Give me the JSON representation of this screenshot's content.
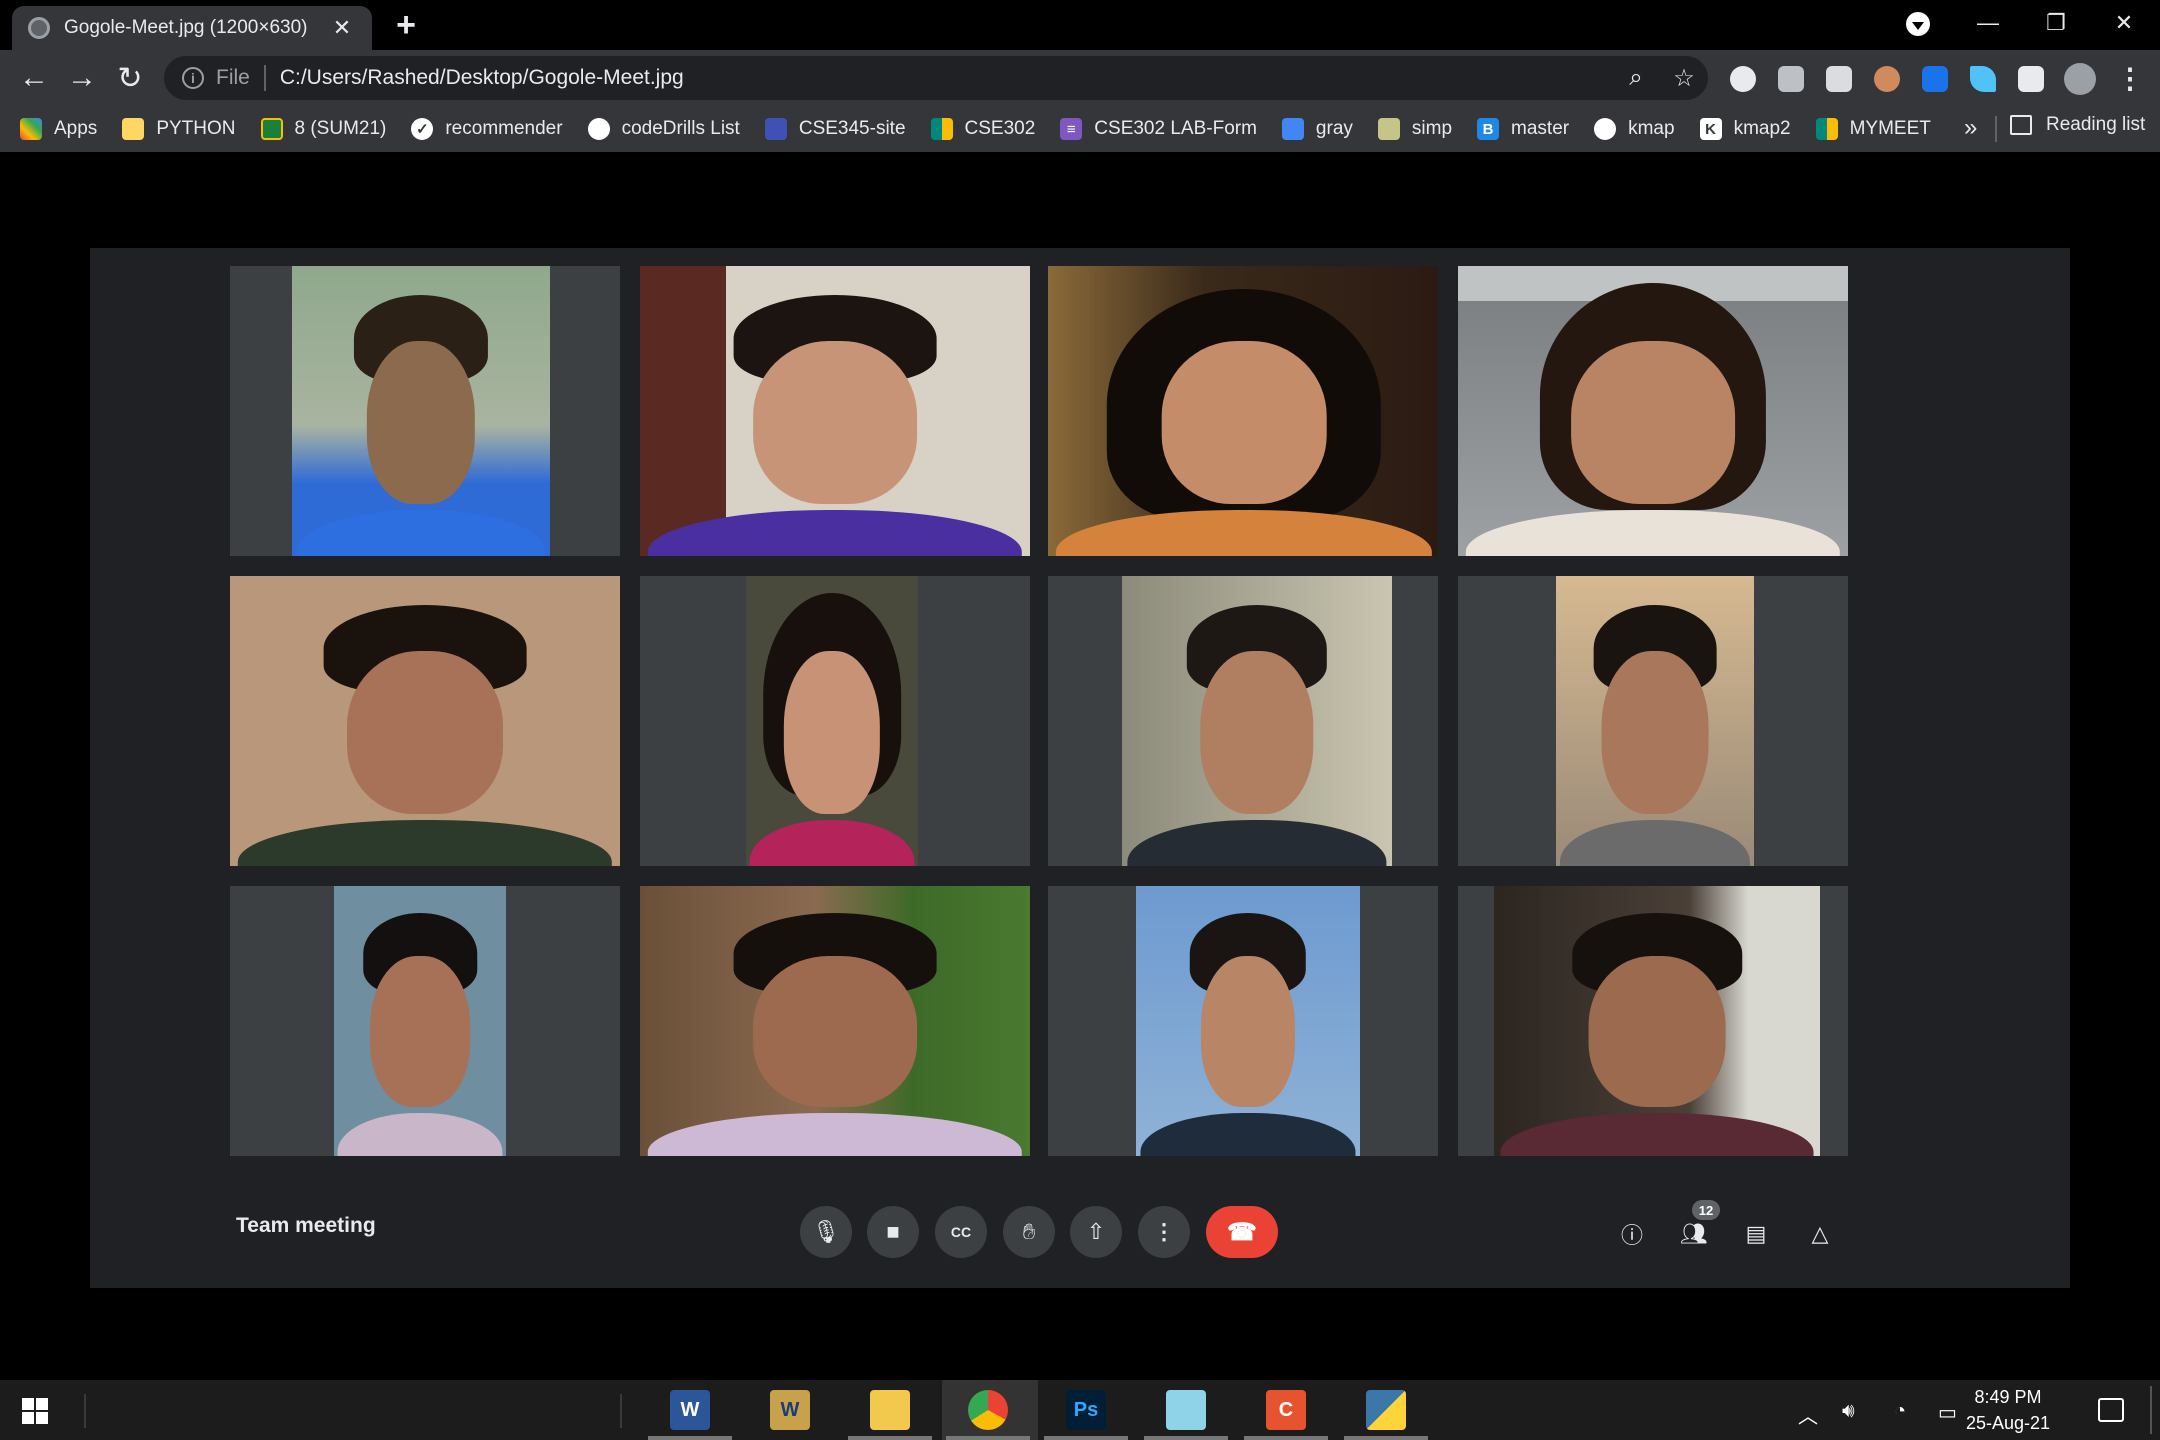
{
  "browser": {
    "tab_title": "Gogole-Meet.jpg (1200×630)",
    "close_glyph": "✕",
    "newtab_glyph": "+",
    "scheme_label": "File",
    "url": "C:/Users/Rashed/Desktop/Gogole-Meet.jpg",
    "bookmarks": [
      {
        "label": "Apps",
        "icon": "apps-grid-icon",
        "color": "#ea4335"
      },
      {
        "label": "PYTHON",
        "icon": "folder-icon",
        "color": "#fdd663"
      },
      {
        "label": "8 (SUM21)",
        "icon": "classroom-icon",
        "color": "#188038"
      },
      {
        "label": "recommender",
        "icon": "check-icon",
        "color": "#ffffff"
      },
      {
        "label": "codeDrills List",
        "icon": "globe-icon",
        "color": "#ffffff"
      },
      {
        "label": "CSE345-site",
        "icon": "site-icon",
        "color": "#3f51b5"
      },
      {
        "label": "CSE302",
        "icon": "meet-icon",
        "color": "#00897b"
      },
      {
        "label": "CSE302 LAB-Form",
        "icon": "forms-icon",
        "color": "#7e57c2"
      },
      {
        "label": "gray",
        "icon": "doc-icon",
        "color": "#4285f4"
      },
      {
        "label": "simp",
        "icon": "image-icon",
        "color": "#c5c58a"
      },
      {
        "label": "master",
        "icon": "b-icon",
        "color": "#1e88e5"
      },
      {
        "label": "kmap",
        "icon": "globe-icon",
        "color": "#ffffff"
      },
      {
        "label": "kmap2",
        "icon": "kmap2-icon",
        "color": "#ffffff"
      },
      {
        "label": "MYMEET",
        "icon": "meet-icon",
        "color": "#00897b"
      }
    ],
    "bookmarks_more": "»",
    "reading_list": "Reading list"
  },
  "meet": {
    "title": "Team meeting",
    "participants_count": "12",
    "end_call_glyph": "☎"
  },
  "taskbar": {
    "time": "8:49 PM",
    "date": "25-Aug-21"
  },
  "colors": {
    "meet_bg": "#202124",
    "tile_bg": "#3c4043",
    "end_call": "#ea4335",
    "chrome_toolbar": "#35363a"
  }
}
